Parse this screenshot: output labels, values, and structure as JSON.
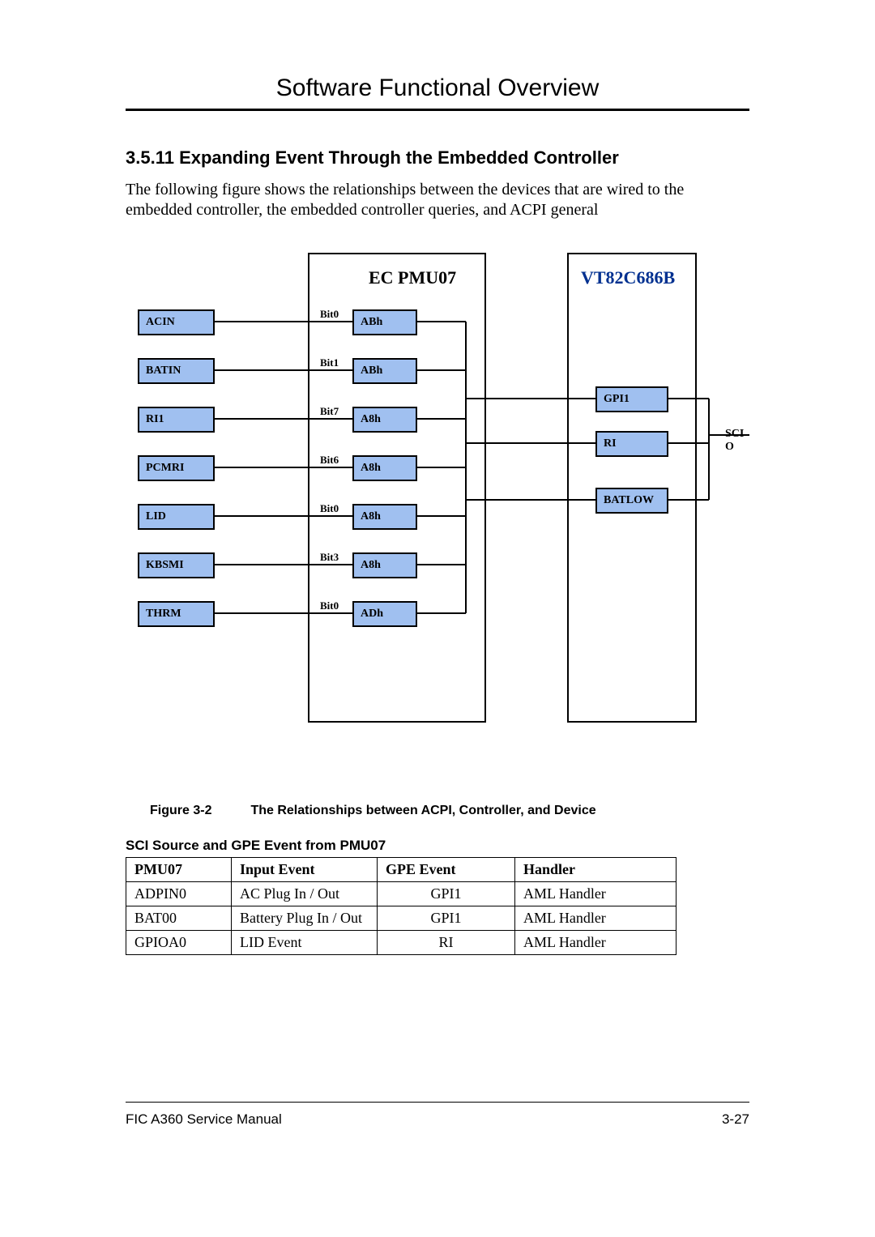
{
  "header": {
    "chapter_title": "Software Functional Overview"
  },
  "section": {
    "number_title": "3.5.11 Expanding Event Through the Embedded Controller",
    "intro": "The following figure shows the relationships between the devices that are wired to the embedded controller, the embedded controller queries, and ACPI general"
  },
  "diagram": {
    "ec_title": "EC PMU07",
    "vt_title": "VT82C686B",
    "sci_out": "SCI O",
    "left_blocks": [
      "ACIN",
      "BATIN",
      "RI1",
      "PCMRI",
      "LID",
      "KBSMI",
      "THRM"
    ],
    "bits": [
      "Bit0",
      "Bit1",
      "Bit7",
      "Bit6",
      "Bit0",
      "Bit3",
      "Bit0"
    ],
    "queries": [
      "ABh",
      "ABh",
      "A8h",
      "A8h",
      "A8h",
      "A8h",
      "ADh"
    ],
    "right_blocks": [
      "GPI1",
      "RI",
      "BATLOW"
    ]
  },
  "figure": {
    "num": "Figure 3-2",
    "caption": "The Relationships between ACPI, Controller, and Device"
  },
  "table": {
    "subhead": "SCI Source and GPE Event from PMU07",
    "headers": [
      "PMU07",
      "Input Event",
      "GPE Event",
      "Handler"
    ],
    "rows": [
      [
        "ADPIN0",
        "AC Plug In / Out",
        "GPI1",
        "AML Handler"
      ],
      [
        "BAT00",
        "Battery Plug In / Out",
        "GPI1",
        "AML Handler"
      ],
      [
        "GPIOA0",
        "LID Event",
        "RI",
        "AML Handler"
      ]
    ]
  },
  "footer": {
    "left": "FIC A360 Service Manual",
    "right": "3-27"
  }
}
